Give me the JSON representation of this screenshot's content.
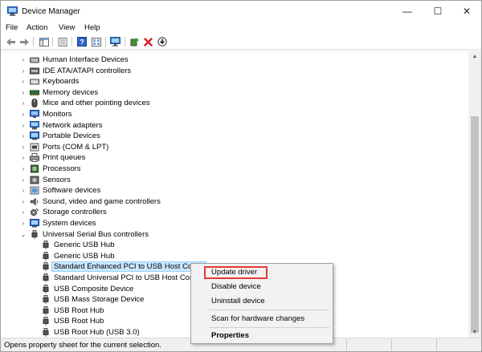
{
  "window": {
    "title": "Device Manager",
    "controls": {
      "minimize": "—",
      "maximize": "☐",
      "close": "✕"
    }
  },
  "menu": [
    "File",
    "Action",
    "View",
    "Help"
  ],
  "toolbar": {
    "buttons": [
      "back-icon",
      "forward-icon",
      "show-hide-tree-icon",
      "properties-icon",
      "help-icon",
      "view-icon",
      "monitor-icon",
      "update-driver-icon",
      "uninstall-icon",
      "download-icon"
    ]
  },
  "tree": {
    "categories_above": [
      "Human Interface Devices",
      "IDE ATA/ATAPI controllers",
      "Keyboards",
      "Memory devices",
      "Mice and other pointing devices",
      "Monitors",
      "Network adapters",
      "Portable Devices",
      "Ports (COM & LPT)",
      "Print queues",
      "Processors",
      "Sensors",
      "Software devices",
      "Sound, video and game controllers",
      "Storage controllers",
      "System devices"
    ],
    "expanded_category": "Universal Serial Bus controllers",
    "children": [
      "Generic USB Hub",
      "Generic USB Hub",
      "Standard Enhanced PCI to USB Host Contro",
      "Standard Universal PCI to USB Host Contro",
      "USB Composite Device",
      "USB Mass Storage Device",
      "USB Root Hub",
      "USB Root Hub",
      "USB Root Hub (USB 3.0)"
    ],
    "selected_child_index": 2
  },
  "context_menu": {
    "items": [
      "Update driver",
      "Disable device",
      "Uninstall device"
    ],
    "scan": "Scan for hardware changes",
    "properties": "Properties",
    "highlighted": "Update driver",
    "highlight_color": "#e53935"
  },
  "status": {
    "text": "Opens property sheet for the current selection."
  },
  "colors": {
    "selection_bg": "#cce8ff",
    "selection_border": "#99d1ff"
  }
}
